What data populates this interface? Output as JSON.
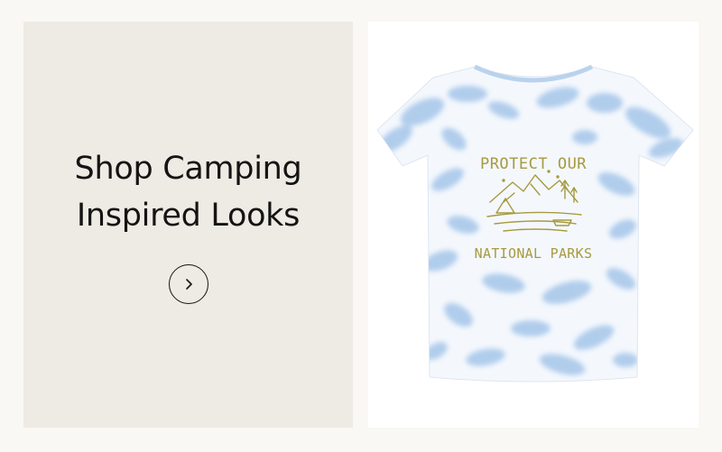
{
  "promo": {
    "title_line1": "Shop Camping",
    "title_line2": "Inspired Looks",
    "arrow_icon": "chevron-right-icon"
  },
  "product": {
    "print_line1": "PROTECT OUR",
    "print_line2": "NATIONAL PARKS"
  },
  "colors": {
    "page_background": "#faf8f4",
    "panel_background": "#eeeae4",
    "text": "#141414",
    "shirt_tie_dye": "#a9c8ea",
    "print_ink": "#a79a3f"
  }
}
